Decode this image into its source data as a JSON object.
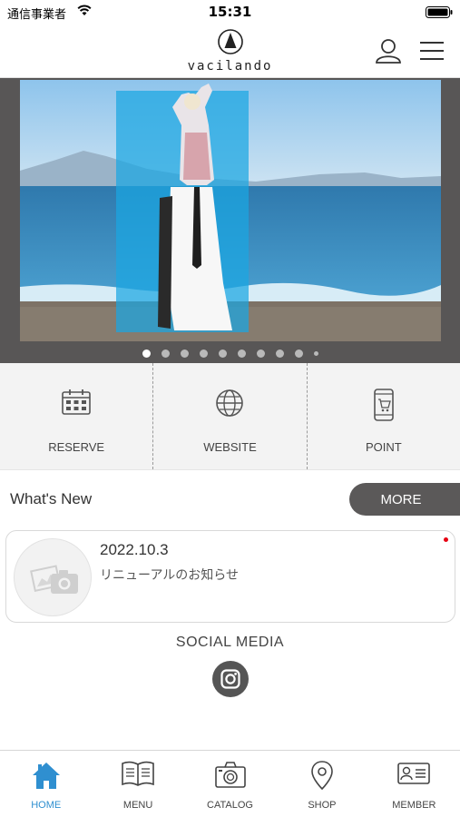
{
  "status_bar": {
    "carrier": "通信事業者",
    "time": "15:31"
  },
  "header": {
    "brand": "vacilando",
    "user_icon": "user-icon",
    "menu_icon": "hamburger-menu-icon"
  },
  "hero": {
    "slides_total": 10,
    "active_slide": 1
  },
  "quick_links": [
    {
      "label": "RESERVE",
      "icon": "calendar-icon"
    },
    {
      "label": "WEBSITE",
      "icon": "globe-icon"
    },
    {
      "label": "POINT",
      "icon": "phone-cart-icon"
    }
  ],
  "whats_new": {
    "title": "What's New",
    "more_label": "MORE",
    "items": [
      {
        "date": "2022.10.3",
        "text": "リニューアルのお知らせ",
        "unread": true
      }
    ]
  },
  "social": {
    "title": "SOCIAL MEDIA",
    "icon": "instagram-icon"
  },
  "tabbar": {
    "active": "HOME",
    "accent_color": "#2f8fd0",
    "items": [
      {
        "label": "HOME",
        "icon": "home-icon"
      },
      {
        "label": "MENU",
        "icon": "book-icon"
      },
      {
        "label": "CATALOG",
        "icon": "camera-icon"
      },
      {
        "label": "SHOP",
        "icon": "map-pin-icon"
      },
      {
        "label": "MEMBER",
        "icon": "id-card-icon"
      }
    ]
  }
}
